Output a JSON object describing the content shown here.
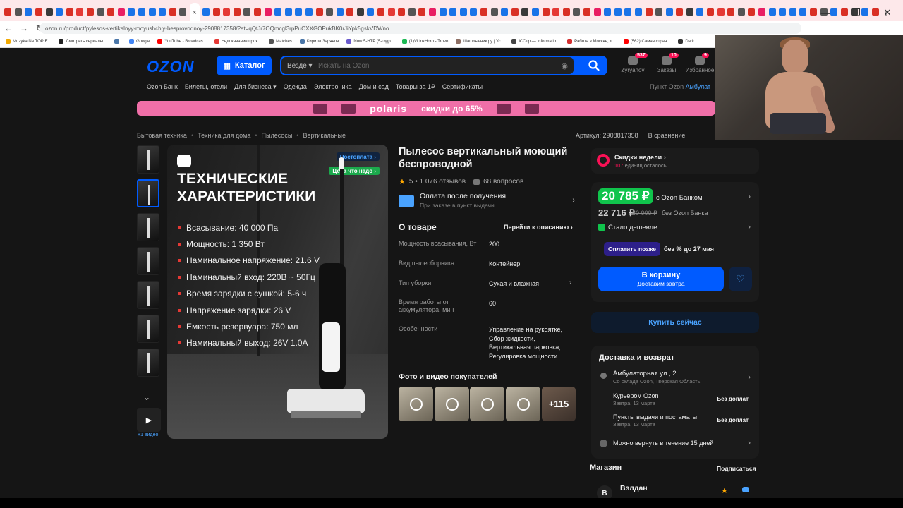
{
  "browser": {
    "url": "ozon.ru/product/pylesos-vertikalnyy-moyushchiy-besprovodnoy-2908817358/?at=qQtJr7OQmcgl3rpPuOXXGOPukBK0rJiYpk5gskVDWno",
    "tab_colors": [
      "#d93025",
      "#555555",
      "#1a73e8",
      "#d93025",
      "#3a3a3a",
      "#1a73e8",
      "#d93025",
      "#e53935",
      "#d93025",
      "#555555",
      "#d93025",
      "#e91e63",
      "#1a73e8",
      "#1a73e8",
      "#1a73e8",
      "#1a73e8"
    ],
    "tab_close": "×",
    "new_tab": "+",
    "window_controls": [
      "—",
      "❐",
      "✕"
    ],
    "nav": [
      "←",
      "→",
      "↻"
    ],
    "bookmarks": [
      {
        "label": "Muzyka Na TOPIE...",
        "color": "#f2a900"
      },
      {
        "label": "Смотреть сериалы...",
        "color": "#222222"
      },
      {
        "label": "",
        "color": "#4a76a8"
      },
      {
        "label": "Google",
        "color": "#4285f4"
      },
      {
        "label": "YouTube - Broadcas...",
        "color": "#ff0000"
      },
      {
        "label": "Недокавание прох...",
        "color": "#e53935"
      },
      {
        "label": "Matches",
        "color": "#555555"
      },
      {
        "label": "Кирилл Зарянов",
        "color": "#4a76a8"
      },
      {
        "label": "Now 5-HTP (5-гидр...",
        "color": "#6a5acd"
      },
      {
        "label": "(1)VLinkHoro - Trovo",
        "color": "#1db954"
      },
      {
        "label": "Шашлычник.ру | Ус...",
        "color": "#8d6e63"
      },
      {
        "label": "iCCup — Informatio...",
        "color": "#444444"
      },
      {
        "label": "Работа в Москве, л...",
        "color": "#d32f2f"
      },
      {
        "label": "(562) Самая стран...",
        "color": "#ff0000"
      },
      {
        "label": "Dark...",
        "color": "#333333"
      }
    ]
  },
  "header": {
    "logo": "OZON",
    "catalog": "Каталог",
    "search_scope": "Везде ▾",
    "search_placeholder": "Искать на Ozon",
    "icons": [
      {
        "label": "Zyryanov",
        "badge": "537"
      },
      {
        "label": "Заказы",
        "badge": "10"
      },
      {
        "label": "Избранное",
        "badge": "9"
      }
    ],
    "nav": [
      "Ozon Банк",
      "Билеты, отели",
      "Для бизнеса ▾",
      "Одежда",
      "Электроника",
      "Дом и сад",
      "Товары за 1₽",
      "Сертификаты"
    ],
    "pickup_label": "Пункт Ozon",
    "pickup_value": "Амбулат"
  },
  "banner": {
    "brand": "polaris",
    "promo": "скидки до 65%"
  },
  "breadcrumbs": [
    "Бытовая техника",
    "Техника для дома",
    "Пылесосы",
    "Вертикальные"
  ],
  "article": {
    "sku": "Артикул: 2908817358",
    "compare": "В сравнение"
  },
  "gallery": {
    "more_video": "+1 видео",
    "image_title": "ТЕХНИЧЕСКИЕ ХАРАКТЕРИСТИКИ",
    "tag_postpay": "Постоплата ›",
    "tag_price": "Цена что надо ›",
    "specs": [
      "Всасывание: 40 000 Па",
      "Мощность: 1 350 Вт",
      "Наминальное напряжение: 21.6 V",
      "Наминальный вход: 220В ~ 50Гц",
      "Время зарядки с сушкой: 5-6 ч",
      "Напряжение зарядки: 26 V",
      "Емкость резервуара: 750 мл",
      "Наминальный выход: 26V 1.0A"
    ]
  },
  "product": {
    "title": "Пылесос вертикальный моющий беспроводной",
    "rating": "5 • 1 076 отзывов",
    "questions": "68 вопросов",
    "pay_title": "Оплата после получения",
    "pay_sub": "При заказе в пункт выдачи",
    "about_title": "О товаре",
    "about_link": "Перейти к описанию ›",
    "attributes": [
      {
        "k": "Мощность всасывания, Вт",
        "v": "200"
      },
      {
        "k": "Вид пылесборника",
        "v": "Контейнер"
      },
      {
        "k": "Тип уборки",
        "v": "Сухая и влажная"
      },
      {
        "k": "Время работы от аккумулятора, мин",
        "v": "60"
      },
      {
        "k": "Особенности",
        "v": "Управление на рукоятке, Сбор жидкости, Вертикальная парковка, Регулировка мощности"
      }
    ],
    "ugc_title": "Фото и видео покупателей",
    "ugc_more": "+115"
  },
  "buybox": {
    "deal_title": "Скидки недели ›",
    "deal_count": "107",
    "deal_sub": " единиц осталось",
    "price_ozon": "20 785 ₽",
    "price_ozon_label": "с Ozon Банком",
    "price_regular": "22 716 ₽",
    "price_old": "60 000 ₽",
    "price_without": "без Ozon Банка",
    "cheaper": "Стало дешевле",
    "paylater_btn": "Оплатить позже",
    "paylater_text": "без % до 27 мая",
    "cart_label": "В корзину",
    "cart_sub": "Доставим завтра",
    "buy_now": "Купить сейчас"
  },
  "delivery": {
    "title": "Доставка и возврат",
    "address": "Амбулаторная ул., 2",
    "address_sub": "Со склада Ozon, Тверская Область",
    "rows": [
      {
        "t": "Курьером Ozon",
        "s": "Завтра, 13 марта",
        "r": "Без доплат"
      },
      {
        "t": "Пункты выдачи и постаматы",
        "s": "Завтра, 13 марта",
        "r": "Без доплат"
      }
    ],
    "return_text": "Можно вернуть в течение 15 дней"
  },
  "shop": {
    "title": "Магазин",
    "subscribe": "Подписаться",
    "avatar": "В",
    "name": "Вэлдан"
  }
}
